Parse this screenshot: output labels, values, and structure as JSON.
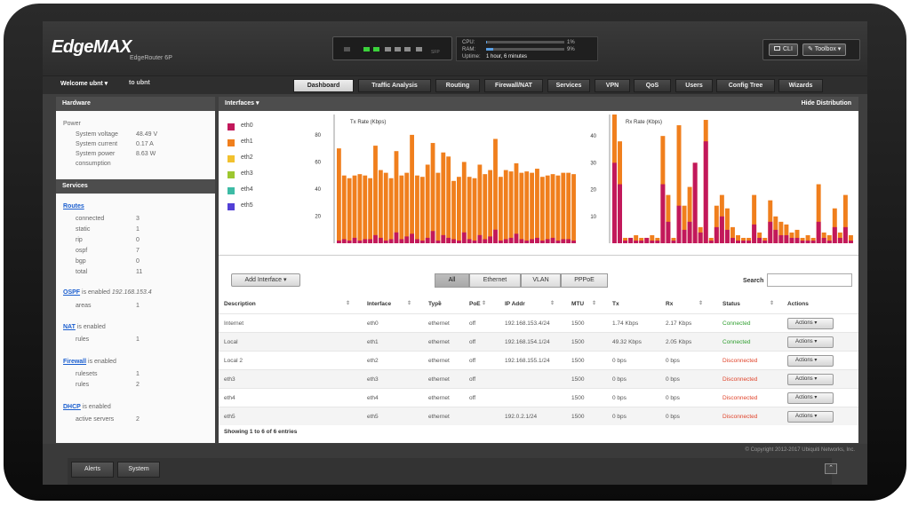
{
  "app": {
    "brand": "EdgeMAX",
    "model": "EdgeRouter 6P"
  },
  "ports": {
    "states": [
      "hidden",
      "up",
      "up",
      "on",
      "on",
      "on",
      "on"
    ],
    "label": "SFP"
  },
  "stats": {
    "cpu_label": "CPU:",
    "cpu_value": "1%",
    "cpu": 0.01,
    "ram_label": "RAM:",
    "ram_value": "9%",
    "ram": 0.09,
    "uptime_label": "Uptime:",
    "uptime_value": "1 hour, 6 minutes"
  },
  "toolbar": {
    "cli": "CLI",
    "toolbox": "Toolbox"
  },
  "welcome": {
    "user": "Welcome ubnt",
    "to": "to ubnt"
  },
  "tabs": [
    "Dashboard",
    "Traffic Analysis",
    "Routing",
    "Firewall/NAT",
    "Services",
    "VPN",
    "QoS",
    "Users",
    "Config Tree",
    "Wizards"
  ],
  "hardware": {
    "title": "Hardware",
    "power": "Power",
    "rows": [
      {
        "label": "System voltage",
        "value": "48.49 V"
      },
      {
        "label": "System current",
        "value": "0.17 A"
      },
      {
        "label": "System power",
        "value": "8.63 W"
      },
      {
        "label": "consumption",
        "value": ""
      }
    ]
  },
  "services": {
    "title": "Services",
    "routes_link": "Routes",
    "routes": [
      {
        "label": "connected",
        "value": "3"
      },
      {
        "label": "static",
        "value": "1"
      },
      {
        "label": "rip",
        "value": "0"
      },
      {
        "label": "ospf",
        "value": "7"
      },
      {
        "label": "bgp",
        "value": "0"
      },
      {
        "label": "total",
        "value": "11"
      }
    ],
    "ospf_link": "OSPF",
    "ospf_text": "is enabled",
    "ospf_ip": "192.168.153.4",
    "areas_label": "areas",
    "areas_value": "1",
    "nat_link": "NAT",
    "nat_text": "is enabled",
    "nat_rules_label": "rules",
    "nat_rules_value": "1",
    "fw_link": "Firewall",
    "fw_text": "is enabled",
    "rulesets_label": "rulesets",
    "rulesets_value": "1",
    "fw_rules_label": "rules",
    "fw_rules_value": "2",
    "dhcp_link": "DHCP",
    "dhcp_text": "is enabled",
    "active_label": "active servers",
    "active_value": "2"
  },
  "interfaces": {
    "title": "Interfaces",
    "hide": "Hide Distribution",
    "legend": [
      {
        "name": "eth0",
        "color": "#c2185b"
      },
      {
        "name": "eth1",
        "color": "#f07f1d"
      },
      {
        "name": "eth2",
        "color": "#f2c12e"
      },
      {
        "name": "eth3",
        "color": "#9dc72f"
      },
      {
        "name": "eth4",
        "color": "#3dbba5"
      },
      {
        "name": "eth5",
        "color": "#5240d6"
      }
    ]
  },
  "chart_data": [
    {
      "type": "bar",
      "title": "Tx Rate (Kbps)",
      "ylim": [
        0,
        95
      ],
      "ticks": [
        20,
        40,
        60,
        80
      ],
      "series": [
        {
          "color": "#f07f1d",
          "values": [
            70,
            50,
            48,
            50,
            51,
            50,
            48,
            72,
            54,
            52,
            48,
            68,
            50,
            52,
            80,
            50,
            49,
            58,
            74,
            52,
            67,
            64,
            46,
            49,
            60,
            49,
            48,
            58,
            51,
            54,
            77,
            49,
            54,
            53,
            59,
            52,
            53,
            52,
            55,
            49,
            50,
            51,
            50,
            52,
            52,
            51
          ]
        },
        {
          "color": "#c2185b",
          "values": [
            2,
            3,
            2,
            4,
            2,
            3,
            3,
            6,
            4,
            2,
            3,
            8,
            3,
            5,
            7,
            3,
            2,
            4,
            9,
            2,
            6,
            4,
            3,
            2,
            8,
            3,
            2,
            6,
            3,
            5,
            10,
            2,
            3,
            4,
            7,
            3,
            2,
            3,
            4,
            2,
            3,
            4,
            2,
            3,
            3,
            2
          ]
        }
      ]
    },
    {
      "type": "bar",
      "title": "Rx Rate (Kbps)",
      "ylim": [
        0,
        48
      ],
      "ticks": [
        10,
        20,
        30,
        40
      ],
      "series": [
        {
          "color": "#f07f1d",
          "values": [
            48,
            38,
            2,
            2,
            3,
            2,
            2,
            3,
            2,
            40,
            18,
            2,
            44,
            14,
            21,
            30,
            6,
            46,
            2,
            14,
            18,
            13,
            6,
            3,
            2,
            2,
            18,
            4,
            2,
            16,
            10,
            8,
            7,
            4,
            5,
            2,
            3,
            2,
            22,
            4,
            3,
            13,
            4,
            18,
            3
          ]
        },
        {
          "color": "#c2185b",
          "values": [
            30,
            22,
            1,
            2,
            1,
            1,
            2,
            1,
            1,
            22,
            8,
            1,
            14,
            5,
            8,
            30,
            4,
            38,
            1,
            6,
            10,
            5,
            2,
            1,
            1,
            1,
            7,
            2,
            1,
            8,
            5,
            3,
            3,
            2,
            2,
            1,
            1,
            1,
            8,
            2,
            1,
            6,
            2,
            6,
            1
          ]
        }
      ]
    }
  ],
  "filters": {
    "add": "Add Interface",
    "segments": [
      "All",
      "Ethernet",
      "VLAN",
      "PPPoE"
    ],
    "search": "Search"
  },
  "columns": [
    "Description",
    "Interface",
    "Type",
    "PoE",
    "IP Addr",
    "MTU",
    "Tx",
    "Rx",
    "Status",
    "Actions"
  ],
  "rows": [
    {
      "desc": "Internet",
      "iface": "eth0",
      "type": "ethernet",
      "poe": "off",
      "ip": "192.168.153.4/24",
      "mtu": "1500",
      "tx": "1.74 Kbps",
      "rx": "2.17 Kbps",
      "status": "Connected",
      "ok": true
    },
    {
      "desc": "Local",
      "iface": "eth1",
      "type": "ethernet",
      "poe": "off",
      "ip": "192.168.154.1/24",
      "mtu": "1500",
      "tx": "49.32 Kbps",
      "rx": "2.05 Kbps",
      "status": "Connected",
      "ok": true
    },
    {
      "desc": "Local 2",
      "iface": "eth2",
      "type": "ethernet",
      "poe": "off",
      "ip": "192.168.155.1/24",
      "mtu": "1500",
      "tx": "0 bps",
      "rx": "0 bps",
      "status": "Disconnected",
      "ok": false
    },
    {
      "desc": "eth3",
      "iface": "eth3",
      "type": "ethernet",
      "poe": "off",
      "ip": "",
      "mtu": "1500",
      "tx": "0 bps",
      "rx": "0 bps",
      "status": "Disconnected",
      "ok": false
    },
    {
      "desc": "eth4",
      "iface": "eth4",
      "type": "ethernet",
      "poe": "off",
      "ip": "",
      "mtu": "1500",
      "tx": "0 bps",
      "rx": "0 bps",
      "status": "Disconnected",
      "ok": false
    },
    {
      "desc": "eth5",
      "iface": "eth5",
      "type": "ethernet",
      "poe": "",
      "ip": "192.0.2.1/24",
      "mtu": "1500",
      "tx": "0 bps",
      "rx": "0 bps",
      "status": "Disconnected",
      "ok": false
    }
  ],
  "actions_label": "Actions",
  "showing": "Showing 1 to 6 of 6 entries",
  "copyright": "© Copyright 2012-2017 Ubiquiti Networks, Inc.",
  "footer_tabs": [
    "Alerts",
    "System"
  ]
}
